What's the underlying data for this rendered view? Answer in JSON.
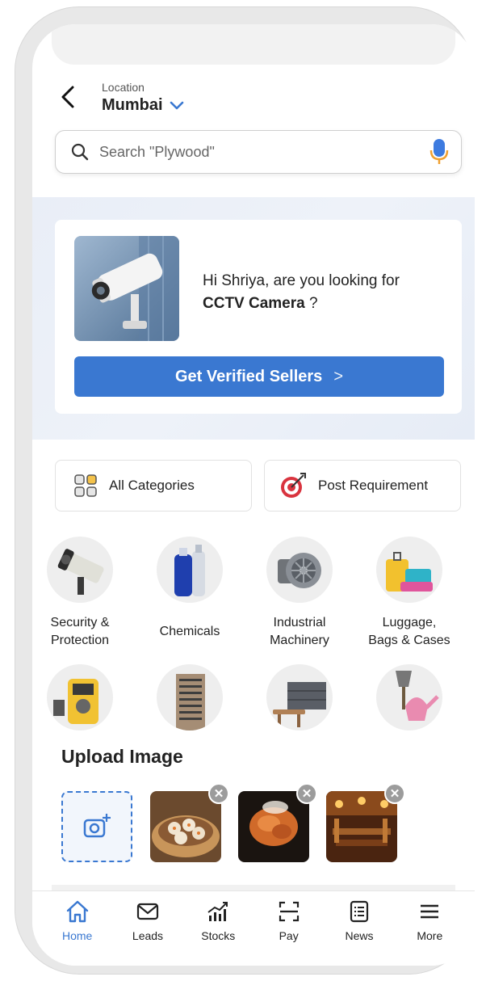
{
  "location": {
    "caption": "Location",
    "city": "Mumbai"
  },
  "search": {
    "placeholder": "Search \"Plywood\""
  },
  "promo": {
    "greeting": "Hi Shriya, are you looking for",
    "product": "CCTV Camera",
    "suffix": " ?",
    "button_label": "Get Verified Sellers",
    "button_chevron": ">"
  },
  "quick_actions": {
    "all_categories": "All Categories",
    "post_requirement": "Post Requirement"
  },
  "categories": [
    {
      "label": "Security &\nProtection",
      "icon": "security-camera-icon"
    },
    {
      "label": "Chemicals",
      "icon": "chemical-bottles-icon"
    },
    {
      "label": "Industrial\nMachinery",
      "icon": "industrial-fan-icon"
    },
    {
      "label": "Luggage,\nBags & Cases",
      "icon": "luggage-icon"
    },
    {
      "label": "",
      "icon": "multimeter-icon"
    },
    {
      "label": "",
      "icon": "building-icon"
    },
    {
      "label": "",
      "icon": "furniture-icon"
    },
    {
      "label": "",
      "icon": "garden-tools-icon"
    }
  ],
  "upload": {
    "title": "Upload Image",
    "images": [
      "dumplings-image",
      "fried-food-image",
      "restaurant-image"
    ]
  },
  "nav": [
    {
      "label": "Home",
      "icon": "home-icon",
      "active": true
    },
    {
      "label": "Leads",
      "icon": "mail-icon",
      "active": false
    },
    {
      "label": "Stocks",
      "icon": "chart-icon",
      "active": false
    },
    {
      "label": "Pay",
      "icon": "scan-icon",
      "active": false
    },
    {
      "label": "News",
      "icon": "news-icon",
      "active": false
    },
    {
      "label": "More",
      "icon": "menu-icon",
      "active": false
    }
  ],
  "colors": {
    "accent": "#3a78d1",
    "mic_blue": "#3d7be0",
    "mic_orange": "#f0a030",
    "target_red": "#d9343f"
  }
}
